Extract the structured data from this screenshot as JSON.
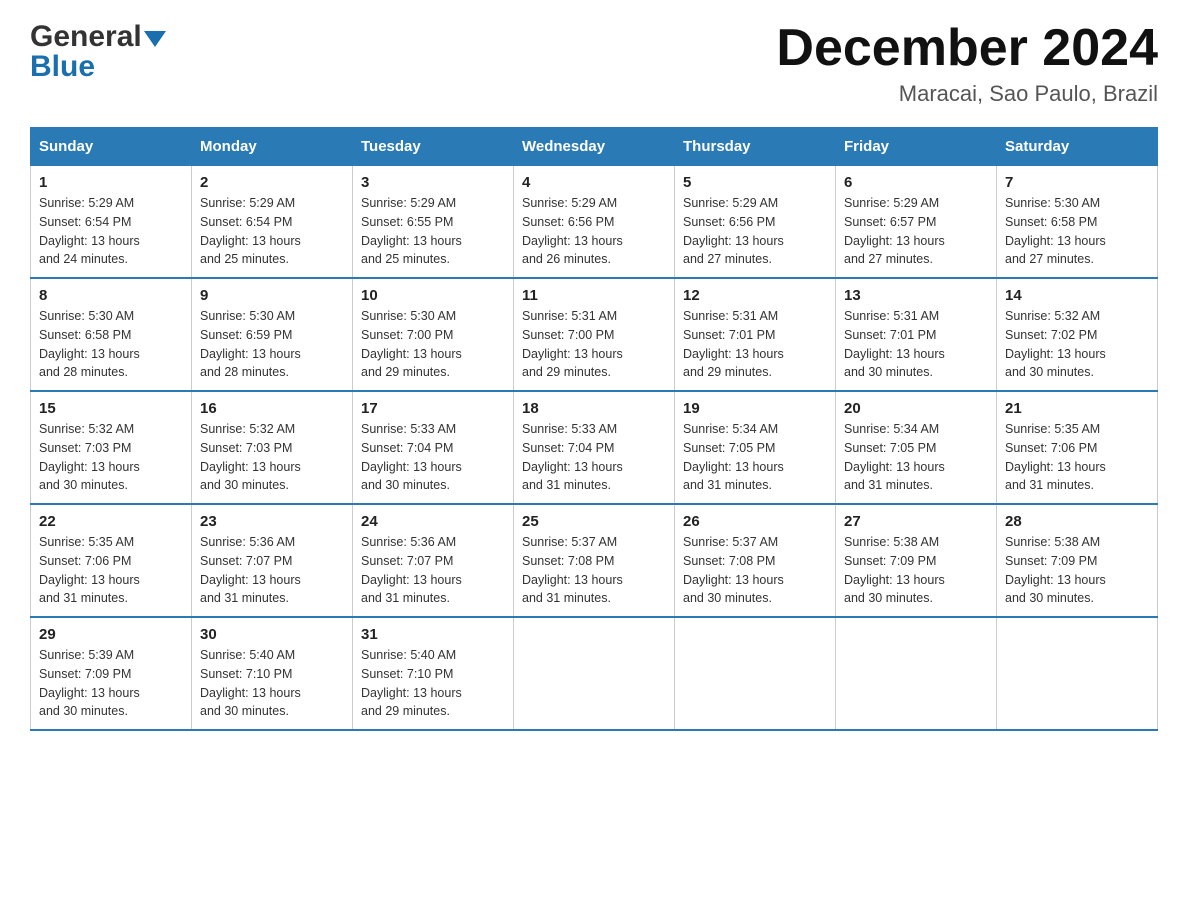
{
  "logo": {
    "line1": "General",
    "line2": "Blue"
  },
  "title": "December 2024",
  "subtitle": "Maracai, Sao Paulo, Brazil",
  "weekdays": [
    "Sunday",
    "Monday",
    "Tuesday",
    "Wednesday",
    "Thursday",
    "Friday",
    "Saturday"
  ],
  "weeks": [
    [
      {
        "day": "1",
        "sunrise": "5:29 AM",
        "sunset": "6:54 PM",
        "daylight": "13 hours and 24 minutes."
      },
      {
        "day": "2",
        "sunrise": "5:29 AM",
        "sunset": "6:54 PM",
        "daylight": "13 hours and 25 minutes."
      },
      {
        "day": "3",
        "sunrise": "5:29 AM",
        "sunset": "6:55 PM",
        "daylight": "13 hours and 25 minutes."
      },
      {
        "day": "4",
        "sunrise": "5:29 AM",
        "sunset": "6:56 PM",
        "daylight": "13 hours and 26 minutes."
      },
      {
        "day": "5",
        "sunrise": "5:29 AM",
        "sunset": "6:56 PM",
        "daylight": "13 hours and 27 minutes."
      },
      {
        "day": "6",
        "sunrise": "5:29 AM",
        "sunset": "6:57 PM",
        "daylight": "13 hours and 27 minutes."
      },
      {
        "day": "7",
        "sunrise": "5:30 AM",
        "sunset": "6:58 PM",
        "daylight": "13 hours and 27 minutes."
      }
    ],
    [
      {
        "day": "8",
        "sunrise": "5:30 AM",
        "sunset": "6:58 PM",
        "daylight": "13 hours and 28 minutes."
      },
      {
        "day": "9",
        "sunrise": "5:30 AM",
        "sunset": "6:59 PM",
        "daylight": "13 hours and 28 minutes."
      },
      {
        "day": "10",
        "sunrise": "5:30 AM",
        "sunset": "7:00 PM",
        "daylight": "13 hours and 29 minutes."
      },
      {
        "day": "11",
        "sunrise": "5:31 AM",
        "sunset": "7:00 PM",
        "daylight": "13 hours and 29 minutes."
      },
      {
        "day": "12",
        "sunrise": "5:31 AM",
        "sunset": "7:01 PM",
        "daylight": "13 hours and 29 minutes."
      },
      {
        "day": "13",
        "sunrise": "5:31 AM",
        "sunset": "7:01 PM",
        "daylight": "13 hours and 30 minutes."
      },
      {
        "day": "14",
        "sunrise": "5:32 AM",
        "sunset": "7:02 PM",
        "daylight": "13 hours and 30 minutes."
      }
    ],
    [
      {
        "day": "15",
        "sunrise": "5:32 AM",
        "sunset": "7:03 PM",
        "daylight": "13 hours and 30 minutes."
      },
      {
        "day": "16",
        "sunrise": "5:32 AM",
        "sunset": "7:03 PM",
        "daylight": "13 hours and 30 minutes."
      },
      {
        "day": "17",
        "sunrise": "5:33 AM",
        "sunset": "7:04 PM",
        "daylight": "13 hours and 30 minutes."
      },
      {
        "day": "18",
        "sunrise": "5:33 AM",
        "sunset": "7:04 PM",
        "daylight": "13 hours and 31 minutes."
      },
      {
        "day": "19",
        "sunrise": "5:34 AM",
        "sunset": "7:05 PM",
        "daylight": "13 hours and 31 minutes."
      },
      {
        "day": "20",
        "sunrise": "5:34 AM",
        "sunset": "7:05 PM",
        "daylight": "13 hours and 31 minutes."
      },
      {
        "day": "21",
        "sunrise": "5:35 AM",
        "sunset": "7:06 PM",
        "daylight": "13 hours and 31 minutes."
      }
    ],
    [
      {
        "day": "22",
        "sunrise": "5:35 AM",
        "sunset": "7:06 PM",
        "daylight": "13 hours and 31 minutes."
      },
      {
        "day": "23",
        "sunrise": "5:36 AM",
        "sunset": "7:07 PM",
        "daylight": "13 hours and 31 minutes."
      },
      {
        "day": "24",
        "sunrise": "5:36 AM",
        "sunset": "7:07 PM",
        "daylight": "13 hours and 31 minutes."
      },
      {
        "day": "25",
        "sunrise": "5:37 AM",
        "sunset": "7:08 PM",
        "daylight": "13 hours and 31 minutes."
      },
      {
        "day": "26",
        "sunrise": "5:37 AM",
        "sunset": "7:08 PM",
        "daylight": "13 hours and 30 minutes."
      },
      {
        "day": "27",
        "sunrise": "5:38 AM",
        "sunset": "7:09 PM",
        "daylight": "13 hours and 30 minutes."
      },
      {
        "day": "28",
        "sunrise": "5:38 AM",
        "sunset": "7:09 PM",
        "daylight": "13 hours and 30 minutes."
      }
    ],
    [
      {
        "day": "29",
        "sunrise": "5:39 AM",
        "sunset": "7:09 PM",
        "daylight": "13 hours and 30 minutes."
      },
      {
        "day": "30",
        "sunrise": "5:40 AM",
        "sunset": "7:10 PM",
        "daylight": "13 hours and 30 minutes."
      },
      {
        "day": "31",
        "sunrise": "5:40 AM",
        "sunset": "7:10 PM",
        "daylight": "13 hours and 29 minutes."
      },
      null,
      null,
      null,
      null
    ]
  ],
  "labels": {
    "sunrise": "Sunrise:",
    "sunset": "Sunset:",
    "daylight": "Daylight:"
  }
}
